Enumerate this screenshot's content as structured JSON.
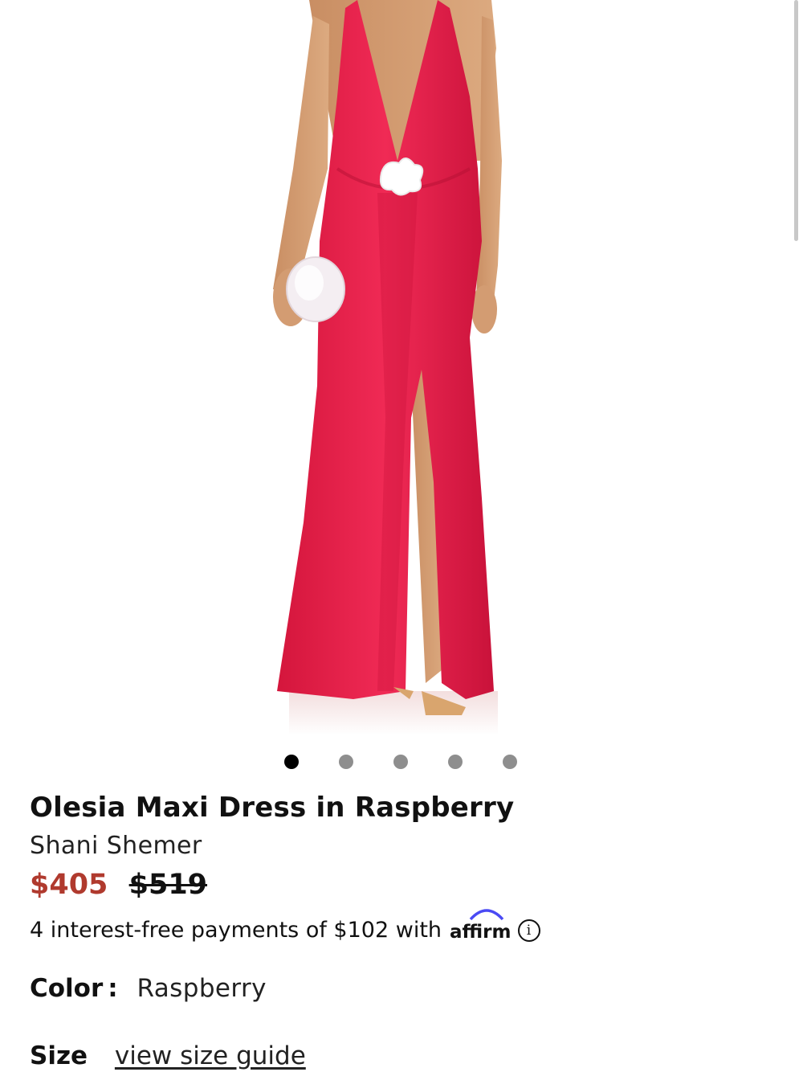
{
  "product": {
    "title": "Olesia Maxi Dress in Raspberry",
    "brand": "Shani Shemer",
    "price_sale": "$405",
    "price_original": "$519",
    "installments_text": "4 interest-free payments of $102 with",
    "affirm_label": "affirm",
    "info_glyph": "i"
  },
  "carousel": {
    "total": 5,
    "active_index": 0
  },
  "color": {
    "label": "Color",
    "separator": ":",
    "value": "Raspberry"
  },
  "size": {
    "label": "Size",
    "guide_link": "view size guide"
  },
  "colors": {
    "dress": "#e8204a",
    "sale_price": "#b03a2e",
    "dot_active": "#000000",
    "dot_inactive": "#8e8e8e",
    "affirm_arc": "#4a4af4"
  }
}
